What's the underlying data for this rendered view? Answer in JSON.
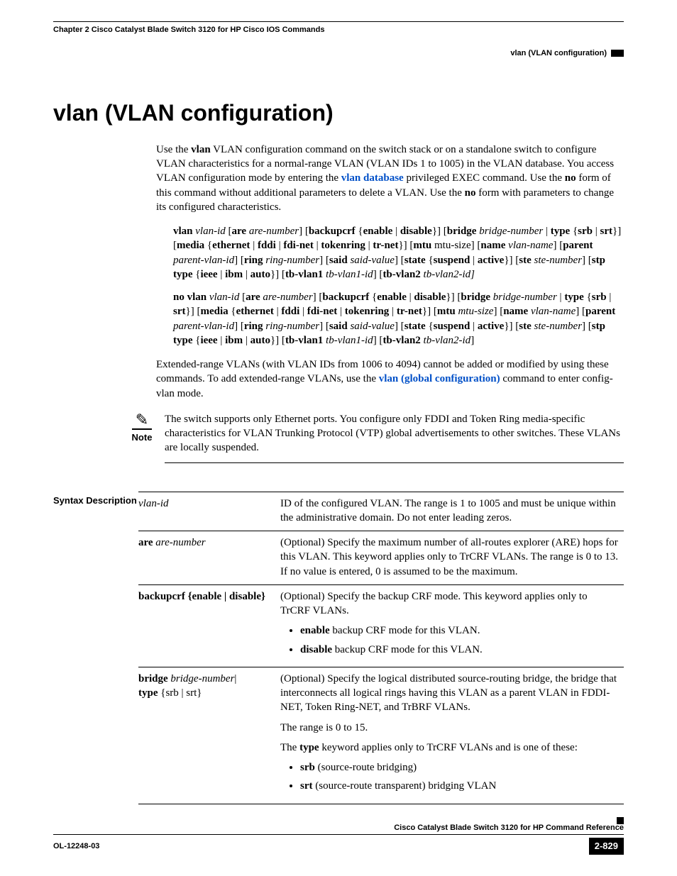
{
  "header": {
    "chapter": "Chapter 2      Cisco Catalyst Blade Switch 3120 for HP Cisco IOS Commands",
    "section": "vlan (VLAN configuration)"
  },
  "title": "vlan (VLAN configuration)",
  "intro": {
    "p1a": "Use the ",
    "p1b": "vlan",
    "p1c": " VLAN configuration command on the switch stack or on a standalone switch to configure VLAN characteristics for a normal-range VLAN (VLAN IDs 1 to 1005) in the VLAN database. You access VLAN configuration mode by entering the ",
    "p1_link1": "vlan database",
    "p1d": " privileged EXEC command. Use the ",
    "p1e": "no",
    "p1f": " form of this command without additional parameters to delete a VLAN. Use the ",
    "p1g": "no",
    "p1h": " form with parameters to change its configured characteristics."
  },
  "extended": {
    "a": "Extended-range VLANs (with VLAN IDs from 1006 to 4094) cannot be added or modified by using these commands. To add extended-range VLANs, use the ",
    "link": "vlan (global configuration)",
    "b": " command to enter config-vlan mode."
  },
  "note": {
    "label": "Note",
    "text": "The switch supports only Ethernet ports. You configure only FDDI and Token Ring media-specific characteristics for VLAN Trunking Protocol (VTP) global advertisements to other switches. These VLANs are locally suspended."
  },
  "syntax_label": "Syntax Description",
  "rows": {
    "r1": {
      "term": "vlan-id",
      "desc": "ID of the configured VLAN. The range is 1 to 1005 and must be unique within the administrative domain. Do not enter leading zeros."
    },
    "r2": {
      "term_b": "are ",
      "term_i": "are-number",
      "desc": "(Optional) Specify the maximum number of all-routes explorer (ARE) hops for this VLAN. This keyword applies only to TrCRF VLANs. The range is 0 to 13. If no value is entered, 0 is assumed to be the maximum."
    },
    "r3": {
      "term": "backupcrf {enable | disable}",
      "desc": "(Optional) Specify the backup CRF mode. This keyword applies only to TrCRF VLANs.",
      "li1a": "enable",
      "li1b": " backup CRF mode for this VLAN.",
      "li2a": "disable",
      "li2b": " backup CRF mode for this VLAN."
    },
    "r4": {
      "term_b1": "bridge ",
      "term_i1": "bridge-number",
      "term_sep": "| ",
      "term_b2": "type ",
      "term_br": "{srb | srt}",
      "desc1": "(Optional) Specify the logical distributed source-routing bridge, the bridge that interconnects all logical rings having this VLAN as a parent VLAN in FDDI-NET, Token Ring-NET, and TrBRF VLANs.",
      "desc2": "The range is 0 to 15.",
      "desc3a": "The ",
      "desc3b": "type",
      "desc3c": " keyword applies only to TrCRF VLANs and is one of these:",
      "li1a": "srb",
      "li1b": " (source-route bridging)",
      "li2a": "srt",
      "li2b": " (source-route transparent) bridging VLAN"
    }
  },
  "footer": {
    "book": "Cisco Catalyst Blade Switch 3120 for HP Command Reference",
    "doc": "OL-12248-03",
    "page": "2-829"
  }
}
